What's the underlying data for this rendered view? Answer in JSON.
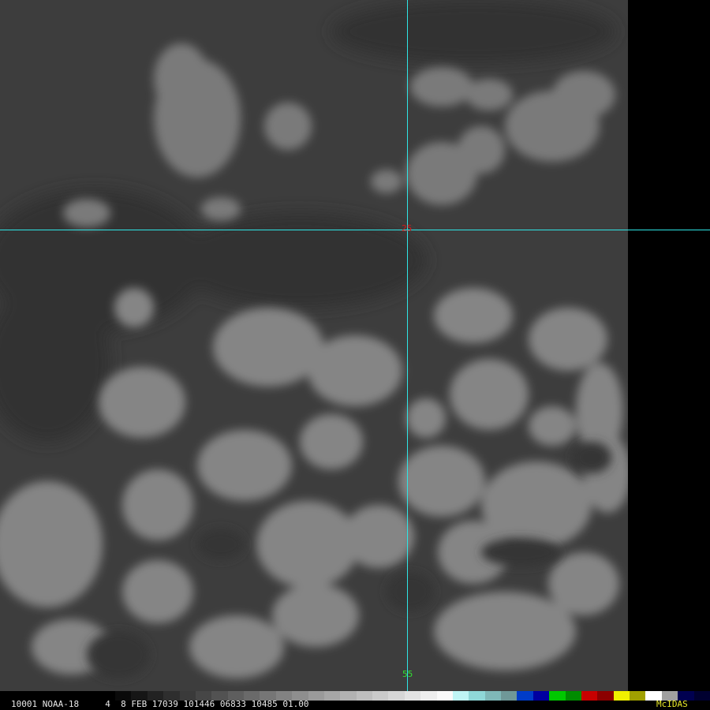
{
  "image": {
    "description": "Visible-channel satellite image of cumulus cloud fields over ocean with a cyan cursor crosshair",
    "background_color": "#3f3f3f",
    "cloud_color": "#8a8a8a",
    "crosshair_color": "#2ee6e6"
  },
  "crosshair": {
    "lat_label": "25",
    "lon_label": "55",
    "lat_label_color": "#d81818",
    "lon_label_color": "#30e030"
  },
  "status_bar": {
    "frame_info": "10001 NOAA-18     4  8 FEB 17039 101446 06833 10485 01.00",
    "software_label": "McIDAS",
    "software_label_color": "#e8e828"
  },
  "color_table": [
    "#0a0a0a",
    "#161616",
    "#222222",
    "#2e2e2e",
    "#3a3a3a",
    "#464646",
    "#525252",
    "#5e5e5e",
    "#6a6a6a",
    "#767676",
    "#828282",
    "#8e8e8e",
    "#9a9a9a",
    "#a6a6a6",
    "#b2b2b2",
    "#bebebe",
    "#cacaca",
    "#d6d6d6",
    "#e2e2e2",
    "#eeeeee",
    "#fafafa",
    "#bff5f5",
    "#8fd8d8",
    "#7fb8b8",
    "#6f9898",
    "#003cc8",
    "#0000a0",
    "#00c800",
    "#008c00",
    "#c80000",
    "#8c0000",
    "#f0f000",
    "#a0a000",
    "#ffffff",
    "#a0a0a0",
    "#000050",
    "#000030"
  ]
}
